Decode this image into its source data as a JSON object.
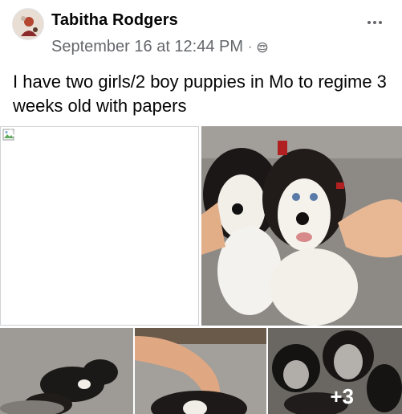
{
  "post": {
    "author": "Tabitha Rodgers",
    "timestamp": "September 16 at 12:44 PM",
    "separator": "·",
    "audience_icon": "globe-icon",
    "more_icon": "more-options-icon",
    "text": "I have two girls/2 boy puppies in Mo to regime 3 weeks old with papers"
  },
  "gallery": {
    "broken_image_icon": "broken-image-icon",
    "extra_count": "+3"
  },
  "colors": {
    "secondary_text": "#65676b",
    "primary_text": "#050505"
  }
}
